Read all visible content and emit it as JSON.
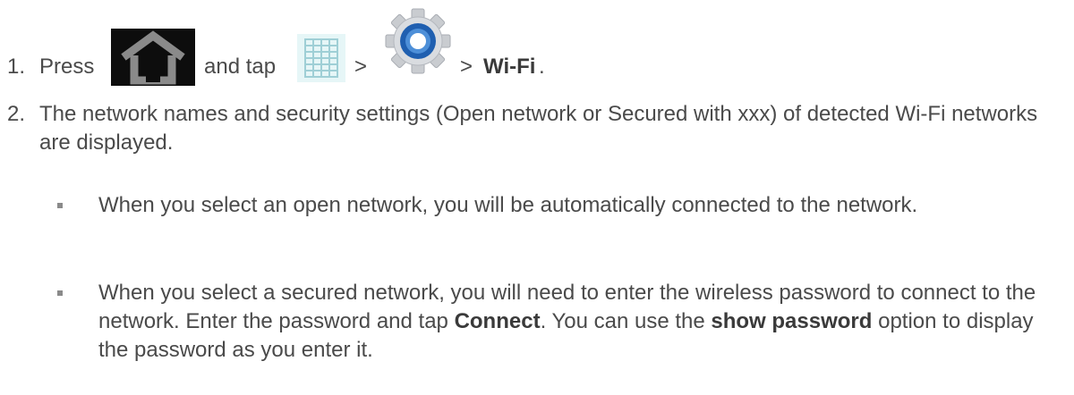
{
  "step1": {
    "number": "1.",
    "press_text": "Press",
    "and_tap_text": "and tap",
    "sep1": ">",
    "sep2": ">",
    "wifi_label": "Wi-Fi",
    "period": ".",
    "icons": {
      "home": "home-icon",
      "apps": "apps-grid-icon",
      "settings": "settings-gear-icon"
    }
  },
  "step2": {
    "number": "2.",
    "text": "The network names and security settings (Open network or Secured with xxx) of detected Wi-Fi networks are displayed."
  },
  "bullets": [
    {
      "text": "When you select an open network, you will be automatically connected to the network."
    },
    {
      "text_before": "When you select a secured network, you will need to enter the wireless password to connect to the network. Enter the password and tap ",
      "bold1": "Connect",
      "text_middle": ". You can use the ",
      "bold2": "show password",
      "text_after": " option to display the password as you enter it."
    }
  ],
  "colors": {
    "text": "#4a4a4a",
    "home_icon_bg": "#0d0d0d",
    "home_icon_fg": "#8a8a8a",
    "apps_icon_bg": "#dff3f5",
    "gear_blue": "#1f5fb0"
  }
}
